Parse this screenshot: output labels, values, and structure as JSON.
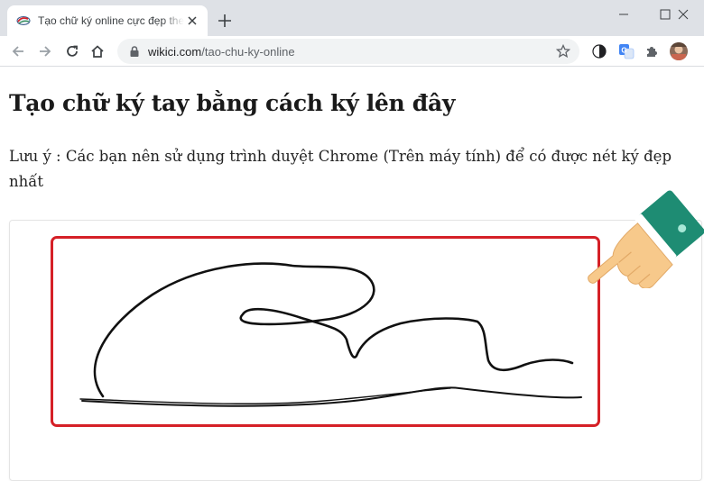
{
  "browser": {
    "tab": {
      "title": "Tạo chữ ký online cực đẹp theo tên"
    },
    "address_bar": {
      "domain": "wikici.com",
      "path": "/tao-chu-ky-online"
    }
  },
  "page": {
    "heading": "Tạo chữ ký tay bằng cách ký lên đây",
    "note": "Lưu ý : Các bạn nên sử dụng trình duyệt Chrome (Trên máy tính) để có được nét ký đẹp nhất"
  },
  "colors": {
    "pad_border": "#d52027",
    "tabstrip": "#dee1e6",
    "cuff": "#1e8c73",
    "skin": "#f7c98b"
  },
  "icons": [
    "favicon-icon",
    "close-icon",
    "plus-icon",
    "minimize-icon",
    "maximize-icon",
    "window-close-icon",
    "back-icon",
    "forward-icon",
    "reload-icon",
    "home-icon",
    "lock-icon",
    "star-icon",
    "extension-dark-mode-icon",
    "translate-icon",
    "puzzle-icon",
    "profile-avatar",
    "pointing-hand-icon"
  ]
}
